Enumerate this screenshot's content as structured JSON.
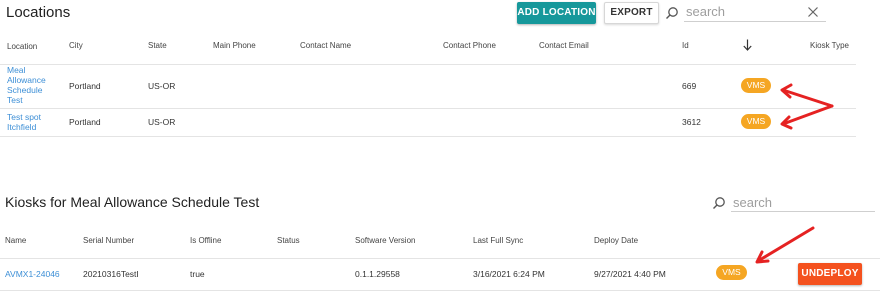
{
  "locations": {
    "title": "Locations",
    "add_label": "ADD LOCATION",
    "export_label": "EXPORT",
    "search_placeholder": "search",
    "columns": [
      "Location",
      "City",
      "State",
      "Main Phone",
      "Contact Name",
      "Contact Phone",
      "Contact Email",
      "Id",
      "Kiosk Type"
    ],
    "rows": [
      {
        "location_lines": [
          "Meal",
          "Allowance",
          "Schedule",
          "Test"
        ],
        "city": "Portland",
        "state": "US-OR",
        "id": "669",
        "kiosk_type": "VMS"
      },
      {
        "location_lines": [
          "Test spot",
          "Itchfield"
        ],
        "city": "Portland",
        "state": "US-OR",
        "id": "3612",
        "kiosk_type": "VMS"
      }
    ]
  },
  "kiosks": {
    "title": "Kiosks for Meal Allowance Schedule Test",
    "search_placeholder": "search",
    "columns": [
      "Name",
      "Serial Number",
      "Is Offline",
      "Status",
      "Software Version",
      "Last Full Sync",
      "Deploy Date"
    ],
    "rows": [
      {
        "name": "AVMX1-24046",
        "serial": "20210316TestI",
        "offline": "true",
        "status": "",
        "software": "0.1.1.29558",
        "last_sync": "3/16/2021 6:24 PM",
        "deploy_date": "9/27/2021 4:40 PM",
        "type": "VMS",
        "action": "UNDEPLOY"
      }
    ]
  },
  "colors": {
    "accent": "#16989b",
    "badge": "#f5a623",
    "undeploy": "#f4511e",
    "link": "#3d8fd6",
    "annotation": "#e52222"
  },
  "icons": [
    "search-icon",
    "clear-icon",
    "sort-arrow-down-icon",
    "annotation-arrow"
  ]
}
